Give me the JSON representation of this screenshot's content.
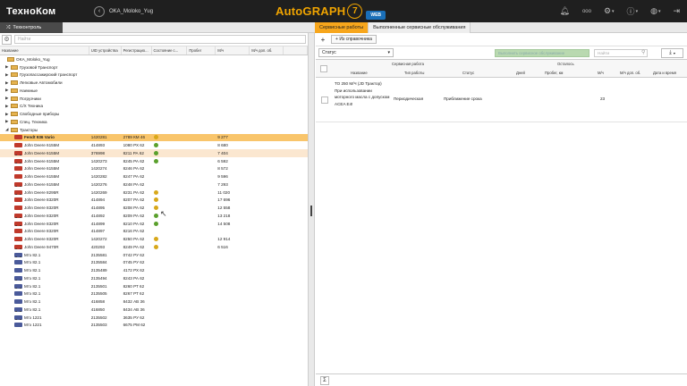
{
  "app": {
    "logo": "ТехноКом",
    "account": "OKA_Moloko_Yug",
    "brand": "AutoGRAPH",
    "brand_version": "7",
    "brand_suffix": "WEB"
  },
  "topbar": {
    "icons": [
      "bell-icon",
      "dots-icon",
      "gear-icon",
      "info-icon",
      "globe-icon",
      "logout-icon"
    ],
    "dots_label": "ooo"
  },
  "subbar": {
    "section": "Техконтроль",
    "tabs": [
      "Сервисные работы",
      "Выполненные сервисные обслуживания"
    ]
  },
  "left": {
    "search_placeholder": "Найти",
    "columns": [
      "Название",
      "UID устройства",
      "Регистрацио...",
      "Состояние с...",
      "Пробег",
      "М/ч",
      "М/ч доп. об.",
      ""
    ],
    "rows": [
      {
        "level": 0,
        "type": "folder",
        "arrow": "",
        "name": "OKA_Moloko_Yug"
      },
      {
        "level": 1,
        "type": "folder",
        "arrow": "▶",
        "name": "Грузовой Транспорт"
      },
      {
        "level": 1,
        "type": "folder",
        "arrow": "▶",
        "name": "Грузопассажирский транспорт"
      },
      {
        "level": 1,
        "type": "folder",
        "arrow": "▶",
        "name": "Легковые Автомобили"
      },
      {
        "level": 1,
        "type": "folder",
        "arrow": "▶",
        "name": "Наемные"
      },
      {
        "level": 1,
        "type": "folder",
        "arrow": "▶",
        "name": "Погрузчики"
      },
      {
        "level": 1,
        "type": "folder",
        "arrow": "▶",
        "name": "С/Х Техника"
      },
      {
        "level": 1,
        "type": "folder",
        "arrow": "▶",
        "name": "Свободные приборы"
      },
      {
        "level": 1,
        "type": "folder",
        "arrow": "▶",
        "name": "Спец. Техника"
      },
      {
        "level": 1,
        "type": "folder",
        "arrow": "◢",
        "name": "Тракторы"
      },
      {
        "level": 2,
        "type": "red",
        "name": "Fendt 936 Vario",
        "uid": "1420281",
        "reg": "2789 КМ 46",
        "state": "yellow",
        "run": "",
        "mh": "9 277",
        "selected": true
      },
      {
        "level": 2,
        "type": "red",
        "name": "John Deere 6155M",
        "uid": "414893",
        "reg": "1080 РХ 62",
        "state": "green",
        "run": "",
        "mh": "8 680"
      },
      {
        "level": 2,
        "type": "red",
        "name": "John Deere 6155M",
        "uid": "376998",
        "reg": "8211 РА 62",
        "state": "green",
        "run": "",
        "mh": "7 404",
        "hover": true
      },
      {
        "level": 2,
        "type": "red",
        "name": "John Deere 6155M",
        "uid": "1420273",
        "reg": "8245 РА 62",
        "state": "green",
        "run": "",
        "mh": "6 592"
      },
      {
        "level": 2,
        "type": "red",
        "name": "John Deere 6155M",
        "uid": "1420274",
        "reg": "8246 РА 62",
        "state": "",
        "run": "",
        "mh": "8 572"
      },
      {
        "level": 2,
        "type": "red",
        "name": "John Deere 6155M",
        "uid": "1420282",
        "reg": "8247 РА 62",
        "state": "",
        "run": "",
        "mh": "9 596"
      },
      {
        "level": 2,
        "type": "red",
        "name": "John Deere 6155M",
        "uid": "1420276",
        "reg": "8248 РА 62",
        "state": "",
        "run": "",
        "mh": "7 293"
      },
      {
        "level": 2,
        "type": "red",
        "name": "John Deere 8295R",
        "uid": "1420269",
        "reg": "8231 РА 62",
        "state": "yellow",
        "run": "",
        "mh": "11 020"
      },
      {
        "level": 2,
        "type": "red",
        "name": "John Deere 8320R",
        "uid": "414894",
        "reg": "8207 РА 62",
        "state": "yellow",
        "run": "",
        "mh": "17 696"
      },
      {
        "level": 2,
        "type": "red",
        "name": "John Deere 8320R",
        "uid": "414895",
        "reg": "8208 РА 62",
        "state": "yellow",
        "run": "",
        "mh": "12 558"
      },
      {
        "level": 2,
        "type": "red",
        "name": "John Deere 8320R",
        "uid": "414892",
        "reg": "8209 РА 62",
        "state": "green",
        "run": "",
        "mh": "13 218"
      },
      {
        "level": 2,
        "type": "red",
        "name": "John Deere 8320R",
        "uid": "414899",
        "reg": "8210 РА 62",
        "state": "green",
        "run": "",
        "mh": "14 508"
      },
      {
        "level": 2,
        "type": "red",
        "name": "John Deere 8320R",
        "uid": "414897",
        "reg": "8216 РА 62",
        "state": "",
        "run": "",
        "mh": ""
      },
      {
        "level": 2,
        "type": "red",
        "name": "John Deere 8320R",
        "uid": "1420272",
        "reg": "8250 РА 62",
        "state": "yellow",
        "run": "",
        "mh": "12 914"
      },
      {
        "level": 2,
        "type": "red",
        "name": "John Deere 9470R",
        "uid": "420293",
        "reg": "8249 РА 62",
        "state": "yellow",
        "run": "",
        "mh": "6 516"
      },
      {
        "level": 2,
        "type": "blue",
        "name": "Мтз 82.1",
        "uid": "2135581",
        "reg": "0742 РУ 62",
        "state": "",
        "run": "",
        "mh": ""
      },
      {
        "level": 2,
        "type": "blue",
        "name": "Мтз 82.1",
        "uid": "2135584",
        "reg": "0745 РУ 62",
        "state": "",
        "run": "",
        "mh": ""
      },
      {
        "level": 2,
        "type": "blue",
        "name": "Мтз 82.1",
        "uid": "2135489",
        "reg": "4172 РХ 62",
        "state": "",
        "run": "",
        "mh": ""
      },
      {
        "level": 2,
        "type": "blue",
        "name": "Мтз 82.1",
        "uid": "2135494",
        "reg": "8243 РА 62",
        "state": "",
        "run": "",
        "mh": ""
      },
      {
        "level": 2,
        "type": "blue",
        "name": "Мтз 82.1",
        "uid": "2135501",
        "reg": "8260 РТ 62",
        "state": "",
        "run": "",
        "mh": ""
      },
      {
        "level": 2,
        "type": "blue",
        "name": "Мтз 82.1",
        "uid": "2135505",
        "reg": "8267 РТ 62",
        "state": "",
        "run": "",
        "mh": ""
      },
      {
        "level": 2,
        "type": "blue",
        "name": "Мтз 82.1",
        "uid": "416858",
        "reg": "8432 АВ 36",
        "state": "",
        "run": "",
        "mh": ""
      },
      {
        "level": 2,
        "type": "blue",
        "name": "Мтз 82.1",
        "uid": "416850",
        "reg": "8434 АВ 36",
        "state": "",
        "run": "",
        "mh": ""
      },
      {
        "level": 2,
        "type": "blue",
        "name": "Мтз 1221",
        "uid": "2135502",
        "reg": "3635 РУ 62",
        "state": "",
        "run": "",
        "mh": ""
      },
      {
        "level": 2,
        "type": "blue",
        "name": "Мтз 1221",
        "uid": "2135503",
        "reg": "6675 РМ 62",
        "state": "",
        "run": "",
        "mh": ""
      }
    ]
  },
  "right": {
    "add_label": "Из справочника",
    "status_label": "Статус",
    "green_button": "Выполнить сервисное обслуживание",
    "filter_placeholder": "Найти",
    "headers": {
      "group1": "Сервисная работа",
      "group2": "Осталось",
      "name": "Название",
      "type": "Тип работы",
      "status": "Статус",
      "days": "Дней",
      "run_km": "Пробег, км",
      "mh": "М/ч",
      "mh_add": "М/ч доп. об.",
      "date": "Дата и время"
    },
    "row": {
      "name": "ТО 250 М/Ч (JD Трактор) При использовании моторного масла с допуском ACEA E4!",
      "type": "Периодическая",
      "status": "Приближение срока",
      "mh": "23"
    },
    "footer_sum": "Σ"
  }
}
